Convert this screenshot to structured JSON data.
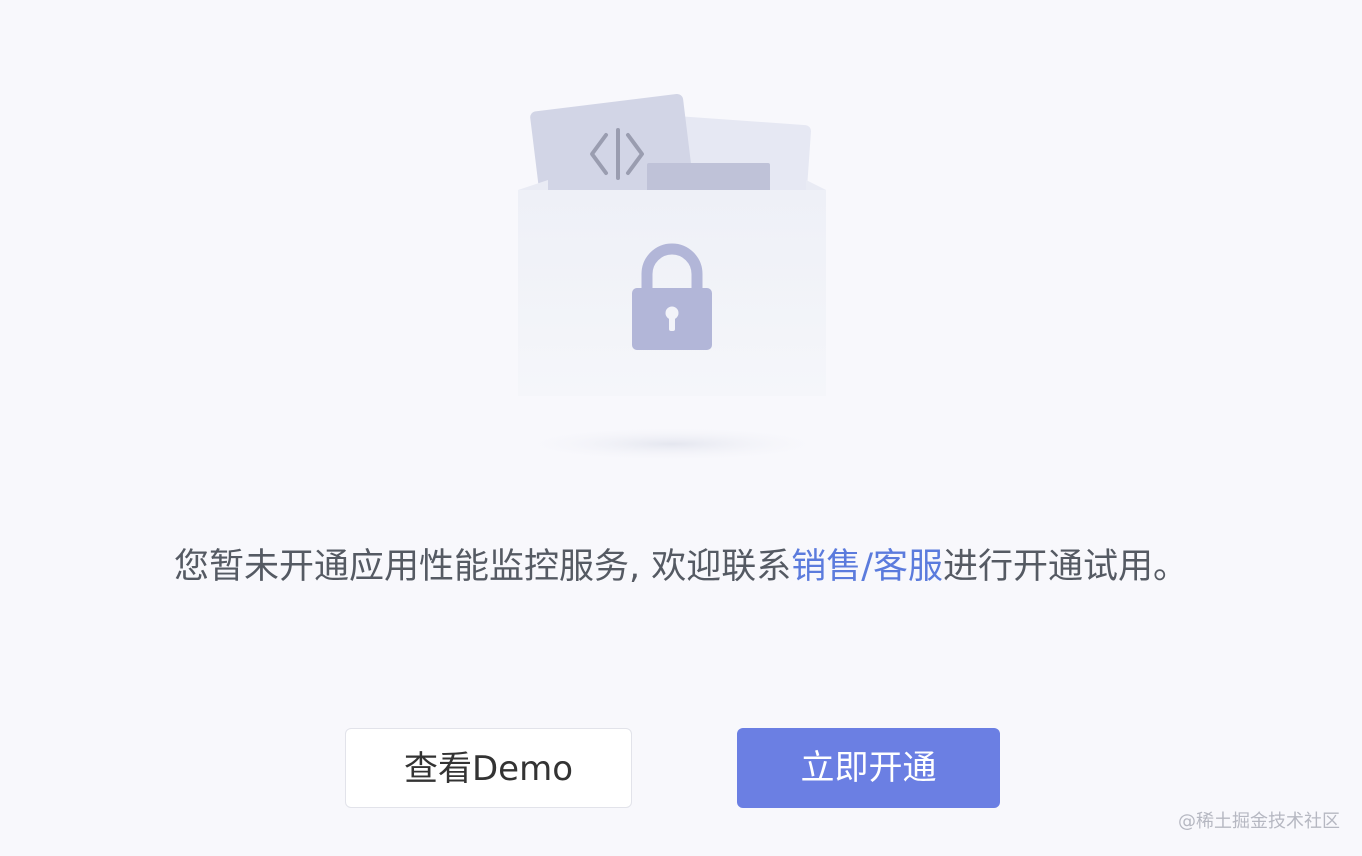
{
  "message": {
    "before_link": "您暂未开通应用性能监控服务, 欢迎联系",
    "link_text": "销售/客服",
    "after_link": "进行开通试用。"
  },
  "buttons": {
    "demo_label": "查看Demo",
    "open_label": "立即开通"
  },
  "watermark": "@稀土掘金技术社区",
  "illustration": {
    "code_icon": "code-brackets-icon",
    "lock_icon": "lock-icon"
  },
  "colors": {
    "background": "#f8f8fc",
    "accent": "#6b7fe3",
    "link": "#5b7bdd",
    "text": "#555a63"
  }
}
